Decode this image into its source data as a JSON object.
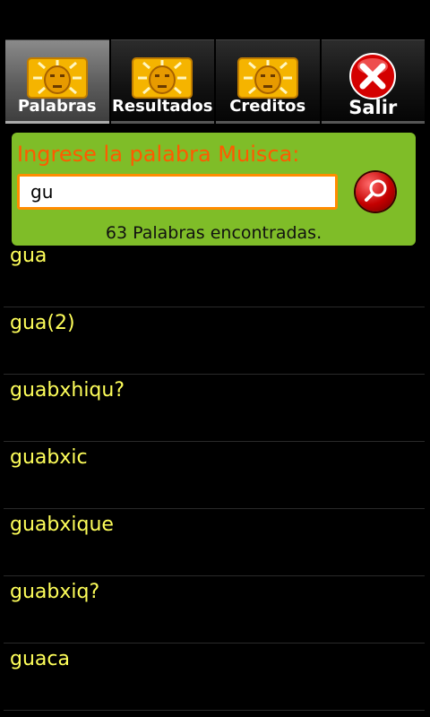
{
  "tabs": [
    {
      "label": "Palabras",
      "icon": "sun-mask-icon",
      "active": true
    },
    {
      "label": "Resultados",
      "icon": "sun-mask-icon",
      "active": false
    },
    {
      "label": "Creditos",
      "icon": "sun-mask-icon",
      "active": false
    },
    {
      "label": "Salir",
      "icon": "close-icon",
      "active": false
    }
  ],
  "search": {
    "prompt": "Ingrese la palabra Muisca:",
    "value": "gu",
    "button_icon": "search-icon",
    "result_count_text": "63 Palabras encontradas."
  },
  "results": [
    "gua",
    "gua(2)",
    "guabxhiqu?",
    "guabxic",
    "guabxique",
    "guabxiq?",
    "guaca"
  ],
  "colors": {
    "panel": "#7fbd28",
    "prompt": "#ff5a00",
    "input_border": "#ff8c00",
    "result_text": "#ffff5a",
    "icon_gold": "#f5b400"
  }
}
